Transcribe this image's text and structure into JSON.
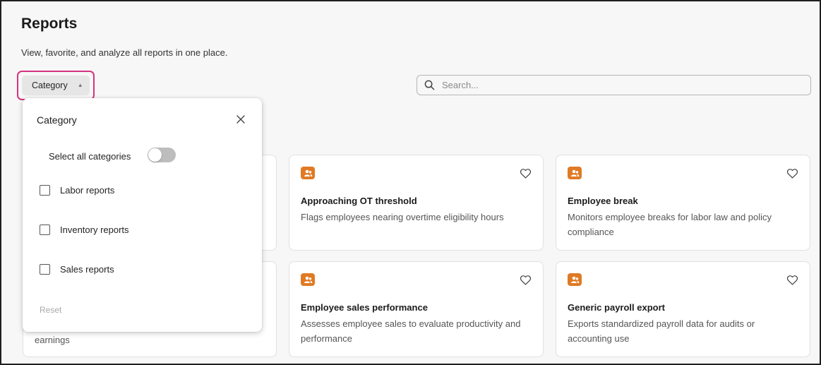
{
  "header": {
    "title": "Reports",
    "subtitle": "View, favorite, and analyze all reports in one place."
  },
  "toolbar": {
    "category_label": "Category",
    "category_caret_icon": "chevron-up-icon",
    "search_placeholder": "Search...",
    "search_icon": "search-icon"
  },
  "dropdown": {
    "title": "Category",
    "close_icon": "close-icon",
    "select_all_label": "Select all categories",
    "select_all_on": false,
    "options": [
      {
        "label": "Labor reports",
        "checked": false
      },
      {
        "label": "Inventory reports",
        "checked": false
      },
      {
        "label": "Sales reports",
        "checked": false
      }
    ],
    "reset_label": "Reset"
  },
  "cards": [
    {
      "title": "Approaching OT threshold",
      "description": "Flags employees nearing overtime eligibility hours",
      "icon": "people-icon",
      "favorite": false
    },
    {
      "title": "Employee break",
      "description": "Monitors employee breaks for labor law and policy compliance",
      "icon": "people-icon",
      "favorite": false
    },
    {
      "title": "Employee sales performance",
      "description": "Assesses employee sales to evaluate productivity and performance",
      "icon": "people-icon",
      "favorite": false
    },
    {
      "title": "Generic payroll export",
      "description": "Exports standardized payroll data for audits or accounting use",
      "icon": "people-icon",
      "favorite": false
    }
  ],
  "obscured_card": {
    "visible_text": "earnings"
  },
  "colors": {
    "accent_badge": "#e07a24",
    "highlight": "#d6337f",
    "toggle_off": "#bdbdbd"
  }
}
